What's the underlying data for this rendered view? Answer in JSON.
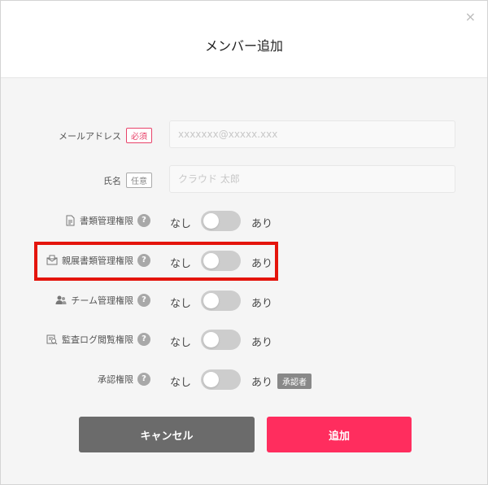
{
  "dialog": {
    "title": "メンバー追加",
    "close_symbol": "×"
  },
  "email": {
    "label": "メールアドレス",
    "badge": "必須",
    "placeholder": "xxxxxxx@xxxxx.xxx"
  },
  "name": {
    "label": "氏名",
    "badge": "任意",
    "placeholder": "クラウド 太郎"
  },
  "permissions": [
    {
      "label": "書類管理権限",
      "icon": "document-icon",
      "off": "なし",
      "on": "あり",
      "enabled": false
    },
    {
      "label": "親展書類管理権限",
      "icon": "confidential-envelope-icon",
      "off": "なし",
      "on": "あり",
      "enabled": false
    },
    {
      "label": "チーム管理権限",
      "icon": "team-icon",
      "off": "なし",
      "on": "あり",
      "enabled": false
    },
    {
      "label": "監査ログ閲覧権限",
      "icon": "audit-log-icon",
      "off": "なし",
      "on": "あり",
      "enabled": false
    },
    {
      "label": "承認権限",
      "icon": "",
      "off": "なし",
      "on": "あり",
      "enabled": false,
      "tag": "承認者"
    }
  ],
  "help_symbol": "?",
  "buttons": {
    "cancel": "キャンセル",
    "add": "追加"
  },
  "colors": {
    "accent": "#ff2d5e",
    "cancel": "#6b6b6b",
    "highlight": "#e4140c",
    "required": "#e8436a"
  }
}
